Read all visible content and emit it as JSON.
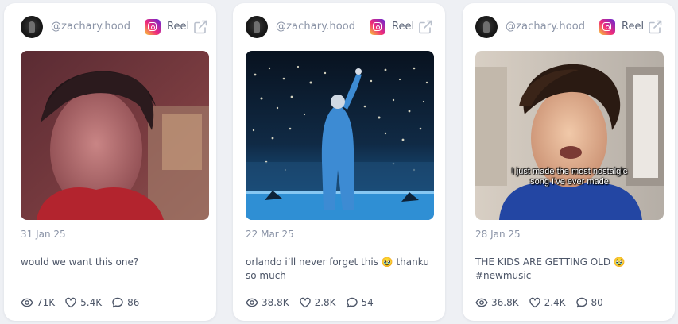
{
  "cards": [
    {
      "handle": "@zachary.hood",
      "platform_label": "Reel",
      "date": "31 Jan 25",
      "text": "would we want this one?",
      "overlay_text": "",
      "stats": {
        "views": "71K",
        "likes": "5.4K",
        "comments": "86"
      }
    },
    {
      "handle": "@zachary.hood",
      "platform_label": "Reel",
      "date": "22 Mar 25",
      "text": "orlando i’ll never forget this 🥹 thanku so much",
      "overlay_text": "",
      "stats": {
        "views": "38.8K",
        "likes": "2.8K",
        "comments": "54"
      }
    },
    {
      "handle": "@zachary.hood",
      "platform_label": "Reel",
      "date": "28 Jan 25",
      "text": "THE KIDS ARE GETTING OLD 🥹 #newmusic",
      "overlay_text": "I just made the most nostalgic song I've ever made",
      "stats": {
        "views": "36.8K",
        "likes": "2.4K",
        "comments": "80"
      }
    }
  ],
  "icons": {
    "platform": "instagram-icon",
    "external": "external-link-icon",
    "views": "eye-icon",
    "likes": "heart-icon",
    "comments": "comment-icon"
  },
  "colors": {
    "muted_text": "#8a93a6",
    "body_text": "#4d5668",
    "card_bg": "#ffffff",
    "page_bg": "#eef0f4"
  }
}
